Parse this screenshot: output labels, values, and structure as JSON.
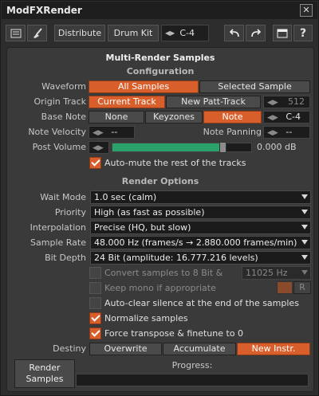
{
  "window": {
    "title": "ModFXRender",
    "close_glyph": "✕"
  },
  "toolbar": {
    "distribute_label": "Distribute",
    "drumkit_label": "Drum Kit",
    "note_value": "C-4"
  },
  "panel": {
    "title": "Multi-Render Samples"
  },
  "configuration": {
    "heading": "Configuration",
    "waveform_label": "Waveform",
    "waveform_options": [
      "All Samples",
      "Selected Sample"
    ],
    "waveform_selected": "All Samples",
    "origin_track_label": "Origin Track",
    "origin_track_options": [
      "Current Track",
      "New Patt-Track"
    ],
    "origin_track_selected": "Current Track",
    "origin_track_value": "512",
    "base_note_label": "Base Note",
    "base_note_options": [
      "None",
      "Keyzones",
      "Note"
    ],
    "base_note_selected": "Note",
    "base_note_value": "C-4",
    "note_velocity_label": "Note Velocity",
    "note_velocity_value": "--",
    "note_panning_label": "Note Panning",
    "note_panning_value": "--",
    "post_volume_label": "Post Volume",
    "post_volume_value": "0.000 dB",
    "post_volume_level": 0.8,
    "automute_label": "Auto-mute the rest of the tracks",
    "automute_checked": true
  },
  "render_options": {
    "heading": "Render Options",
    "wait_mode_label": "Wait Mode",
    "wait_mode_value": "1.0 sec (calm)",
    "priority_label": "Priority",
    "priority_value": "High (as fast as possible)",
    "interpolation_label": "Interpolation",
    "interpolation_value": "Precise (HQ, but slow)",
    "sample_rate_label": "Sample Rate",
    "sample_rate_value": "48.000 Hz (frames/s → 2.880.000 frames/min)",
    "bit_depth_label": "Bit Depth",
    "bit_depth_value": "24 Bit (amplitude: 16.777.216 levels)",
    "convert_label": "Convert samples to 8 Bit &",
    "convert_checked": false,
    "convert_rate_value": "11025 Hz",
    "keep_mono_label": "Keep mono if appropriate",
    "keep_mono_checked": false,
    "lr_left": "L",
    "lr_right": "R",
    "autoclear_label": "Auto-clear silence at the end of the samples",
    "autoclear_checked": false,
    "normalize_label": "Normalize samples",
    "normalize_checked": true,
    "force_transpose_label": "Force transpose & finetune to 0",
    "force_transpose_checked": true,
    "destiny_label": "Destiny",
    "destiny_options": [
      "Overwrite",
      "Accumulate",
      "New Instr."
    ],
    "destiny_selected": "New Instr."
  },
  "footer": {
    "render_line1": "Render",
    "render_line2": "Samples",
    "progress_label": "Progress:",
    "progress_value": 0
  },
  "colors": {
    "accent": "#d85f2b",
    "slider_fill": "#2aa06a"
  },
  "icons": [
    "clipboard-icon",
    "broom-icon",
    "arrows-icon",
    "undo-icon",
    "redo-icon",
    "window-icon",
    "help-icon",
    "close-icon"
  ]
}
